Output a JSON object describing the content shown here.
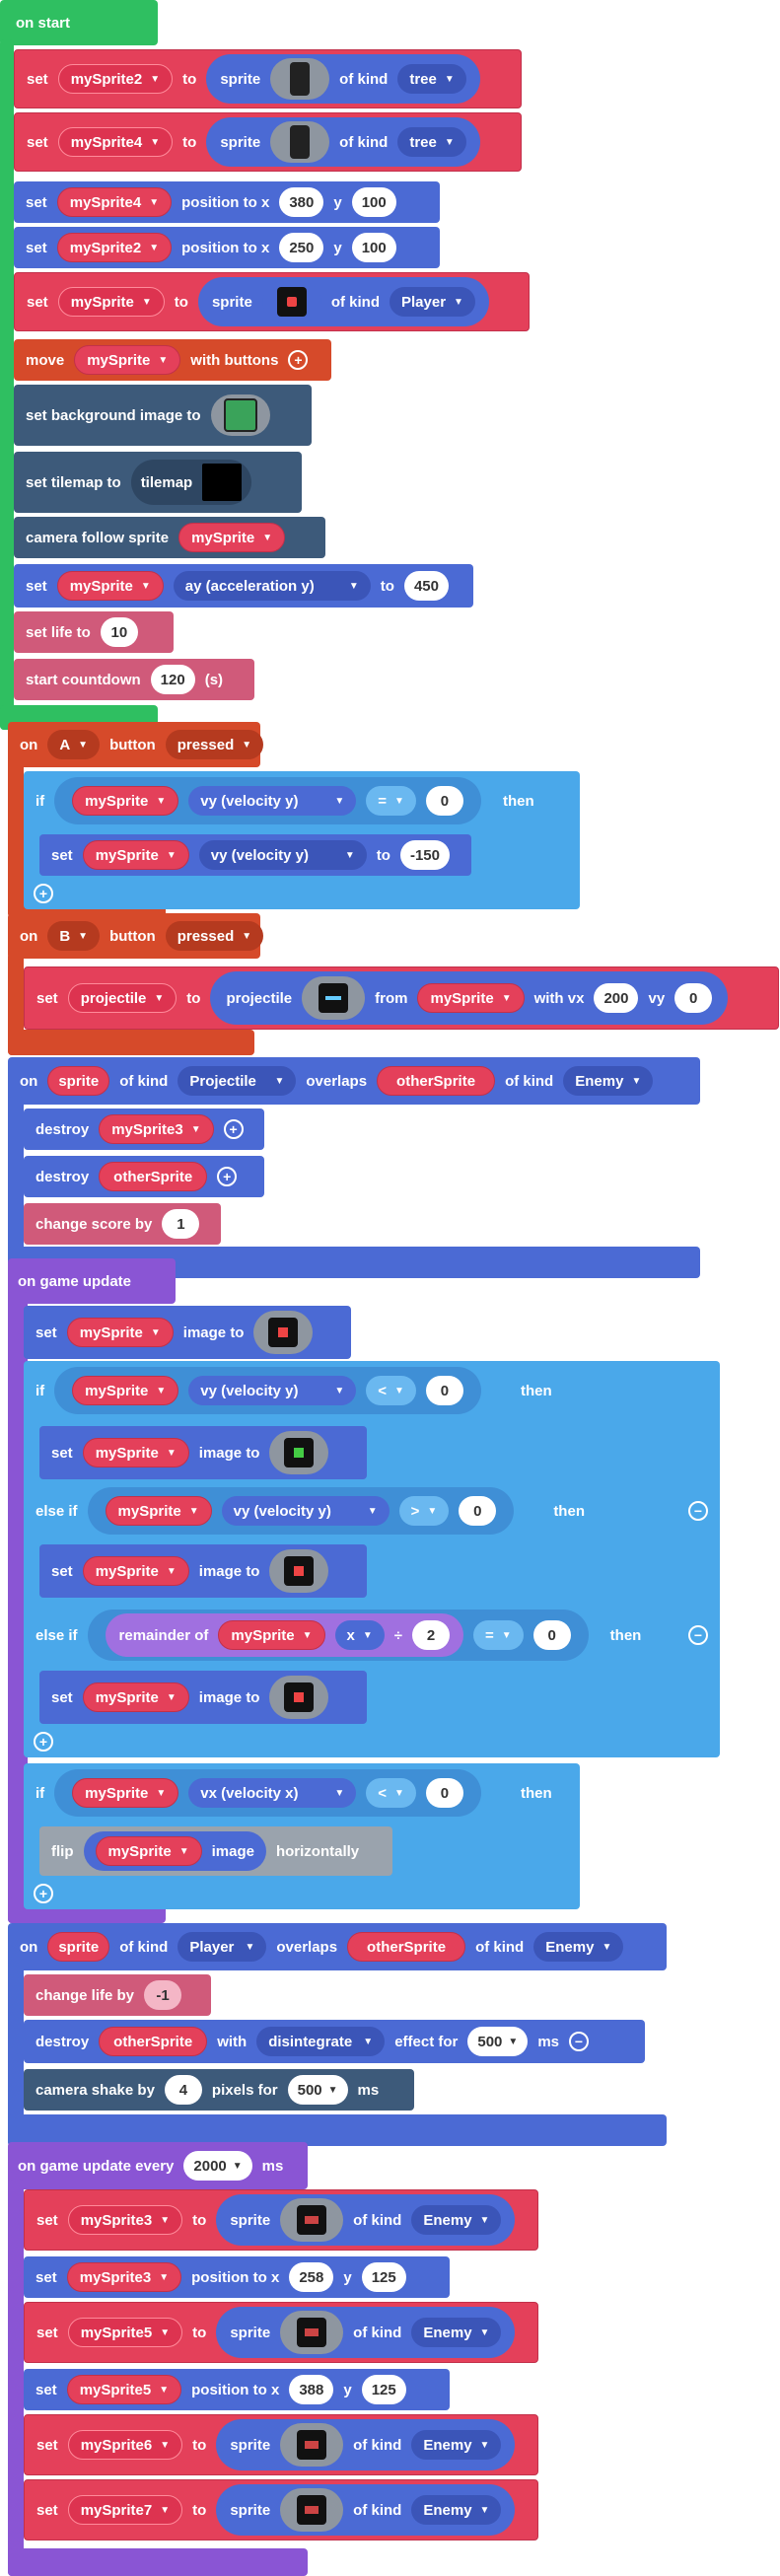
{
  "colors": {
    "on_start": "#2fbf61",
    "sprites": "#4b6ad4",
    "variables": "#e4405a",
    "controller": "#d64a2a",
    "logic": "#4aa8ea",
    "info": "#d05a7a",
    "loops": "#8a55d4",
    "scene": "#3d5a7a",
    "math": "#a070e0"
  },
  "on_start": {
    "hat": "on start",
    "set": "set",
    "to": "to",
    "sprite": "sprite",
    "of_kind": "of kind",
    "v_mySprite2": "mySprite2",
    "v_mySprite4": "mySprite4",
    "v_mySprite": "mySprite",
    "kind_tree": "tree",
    "kind_player": "Player",
    "position_to_x": "position to x",
    "y": "y",
    "x380": "380",
    "y100a": "100",
    "x250": "250",
    "y100b": "100",
    "move": "move",
    "with_buttons": "with buttons",
    "bg_label": "set background image to",
    "tilemap_label": "set tilemap to",
    "tilemap": "tilemap",
    "camera_follow": "camera follow sprite",
    "ay": "ay (acceleration y)",
    "ay_val": "450",
    "set_life": "set life to",
    "life_val": "10",
    "countdown": "start countdown",
    "countdown_val": "120",
    "seconds": "(s)"
  },
  "on_a": {
    "on": "on",
    "button": "A",
    "button_word": "button",
    "event": "pressed",
    "if": "if",
    "then": "then",
    "var": "mySprite",
    "prop": "vy (velocity y)",
    "op": "=",
    "cmp": "0",
    "set": "set",
    "to": "to",
    "set_var": "mySprite",
    "set_prop": "vy (velocity y)",
    "val": "-150"
  },
  "on_b": {
    "on": "on",
    "button": "B",
    "button_word": "button",
    "event": "pressed",
    "set": "set",
    "var": "projectile",
    "to": "to",
    "proj": "projectile",
    "from": "from",
    "src": "mySprite",
    "with_vx": "with vx",
    "vx": "200",
    "vy_label": "vy",
    "vy": "0"
  },
  "overlap1": {
    "on": "on",
    "sprite": "sprite",
    "of_kind": "of kind",
    "kind1": "Projectile",
    "overlaps": "overlaps",
    "other": "otherSprite",
    "of_kind2": "of kind",
    "kind2": "Enemy",
    "destroy": "destroy",
    "d1": "mySprite3",
    "d2": "otherSprite",
    "change_score": "change score by",
    "score": "1"
  },
  "update": {
    "hat": "on game update",
    "set": "set",
    "image_to": "image to",
    "v": "mySprite",
    "if": "if",
    "else_if": "else if",
    "then": "then",
    "vy": "vy (velocity y)",
    "vx": "vx (velocity x)",
    "lt": "<",
    "gt": ">",
    "zero": "0",
    "remainder": "remainder of",
    "x": "x",
    "div": "÷",
    "two": "2",
    "eq": "=",
    "flip": "flip",
    "image": "image",
    "horizontally": "horizontally"
  },
  "overlap2": {
    "on": "on",
    "sprite": "sprite",
    "of_kind": "of kind",
    "kind1": "Player",
    "overlaps": "overlaps",
    "other": "otherSprite",
    "of_kind2": "of kind",
    "kind2": "Enemy",
    "change_life": "change life by",
    "life": "-1",
    "destroy": "destroy",
    "target": "otherSprite",
    "with": "with",
    "effect": "disintegrate",
    "effect_for": "effect for",
    "ms_val": "500",
    "ms": "ms",
    "shake": "camera shake by",
    "shake_val": "4",
    "pixels_for": "pixels for",
    "shake_ms": "500",
    "ms2": "ms"
  },
  "every": {
    "hat": "on game update every",
    "interval": "2000",
    "ms": "ms",
    "set": "set",
    "to": "to",
    "sprite": "sprite",
    "of_kind": "of kind",
    "enemy": "Enemy",
    "position_to_x": "position to x",
    "y": "y",
    "s3": "mySprite3",
    "s5": "mySprite5",
    "s6": "mySprite6",
    "s7": "mySprite7",
    "x258": "258",
    "y125a": "125",
    "x388": "388",
    "y125b": "125"
  }
}
